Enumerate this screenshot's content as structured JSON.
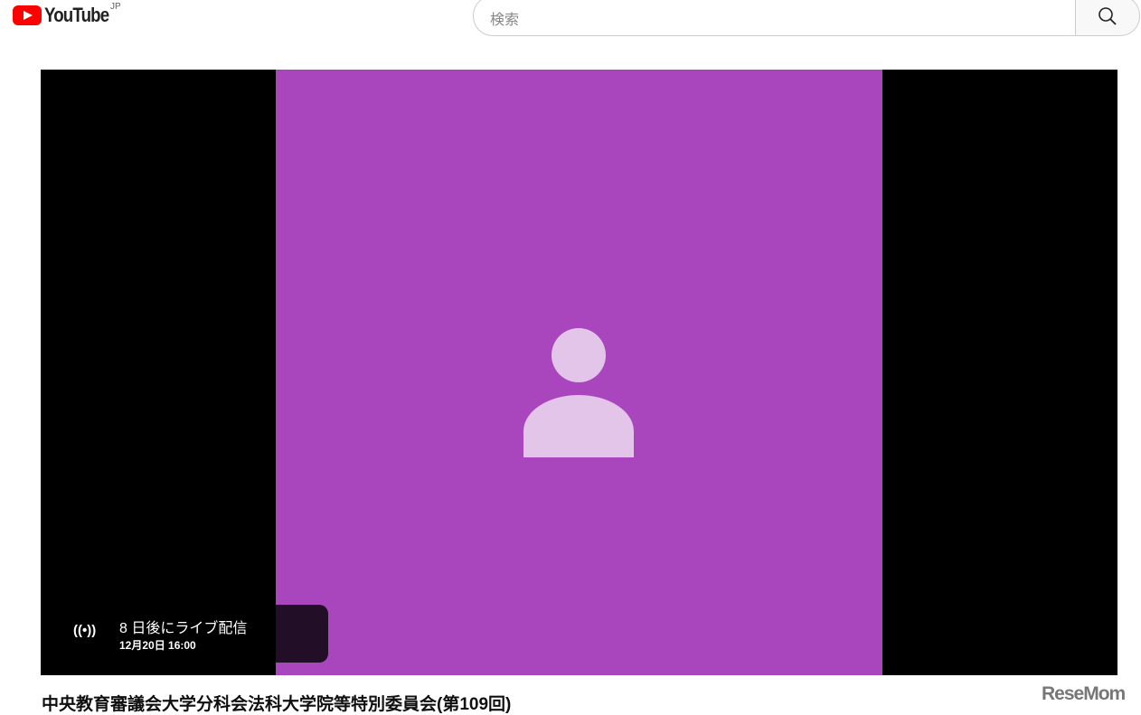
{
  "header": {
    "logo_text": "YouTube",
    "country_code": "JP",
    "search_placeholder": "検索"
  },
  "player": {
    "live_title": "8 日後にライブ配信",
    "live_date": "12月20日 16:00",
    "tile_color": "#a946bd"
  },
  "video": {
    "title": "中央教育審議会大学分科会法科大学院等特別委員会(第109回)"
  },
  "watermark": "ReseMom"
}
